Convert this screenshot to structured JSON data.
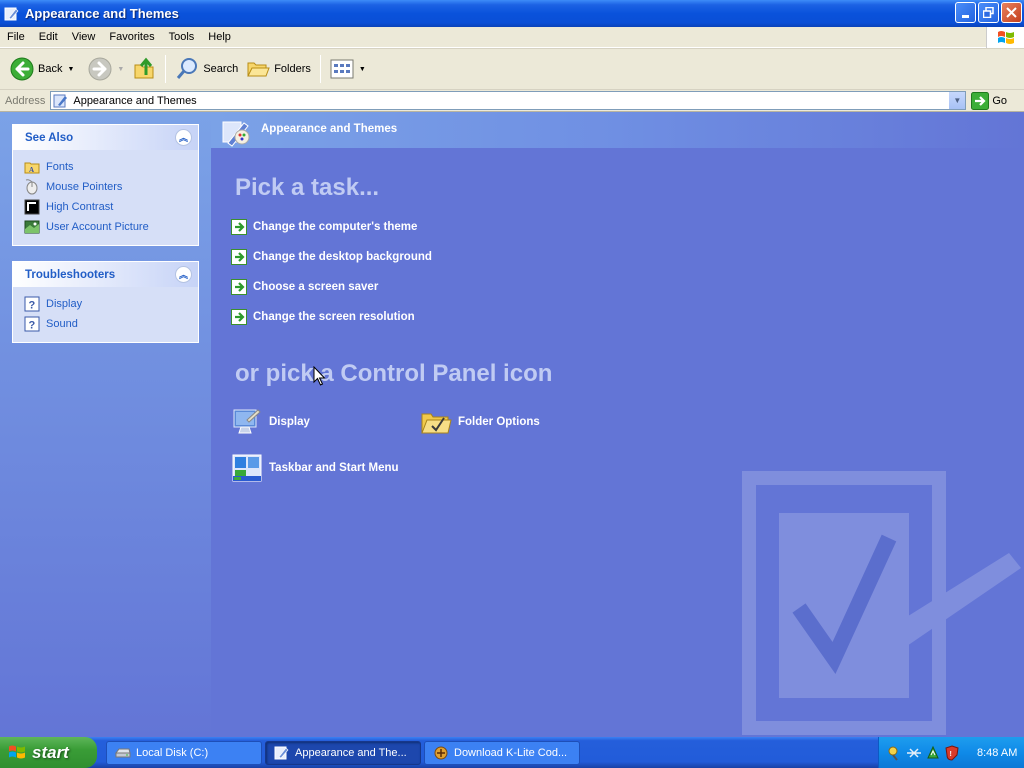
{
  "window": {
    "title": "Appearance and Themes"
  },
  "menubar": {
    "items": [
      "File",
      "Edit",
      "View",
      "Favorites",
      "Tools",
      "Help"
    ]
  },
  "toolbar": {
    "back_label": "Back",
    "search_label": "Search",
    "folders_label": "Folders"
  },
  "address": {
    "label": "Address",
    "value": "Appearance and Themes",
    "go_label": "Go"
  },
  "see_also": {
    "title": "See Also",
    "items": [
      {
        "label": "Fonts",
        "icon": "fonts-folder-icon"
      },
      {
        "label": "Mouse Pointers",
        "icon": "mouse-icon"
      },
      {
        "label": "High Contrast",
        "icon": "high-contrast-icon"
      },
      {
        "label": "User Account Picture",
        "icon": "user-picture-icon"
      }
    ]
  },
  "troubleshooters": {
    "title": "Troubleshooters",
    "items": [
      {
        "label": "Display",
        "icon": "help-icon"
      },
      {
        "label": "Sound",
        "icon": "help-icon"
      }
    ]
  },
  "main": {
    "header_title": "Appearance and Themes",
    "pick_task": "Pick a task...",
    "tasks": [
      "Change the computer's theme",
      "Change the desktop background",
      "Choose a screen saver",
      "Change the screen resolution"
    ],
    "or_pick": "or pick a Control Panel icon",
    "icons": [
      {
        "label": "Display",
        "icon": "display-icon"
      },
      {
        "label": "Folder Options",
        "icon": "folder-options-icon"
      },
      {
        "label": "Taskbar and Start Menu",
        "icon": "taskbar-icon"
      }
    ]
  },
  "taskbar": {
    "start_label": "start",
    "buttons": [
      {
        "label": "Local Disk (C:)",
        "active": false
      },
      {
        "label": "Appearance and The...",
        "active": true
      },
      {
        "label": "Download K-Lite Cod...",
        "active": false
      }
    ],
    "clock": "8:48 AM"
  },
  "colors": {
    "main_bg": "#6375d6",
    "link": "#215dc6",
    "titlebar": "#0a52db",
    "start_green": "#3a9d37"
  }
}
